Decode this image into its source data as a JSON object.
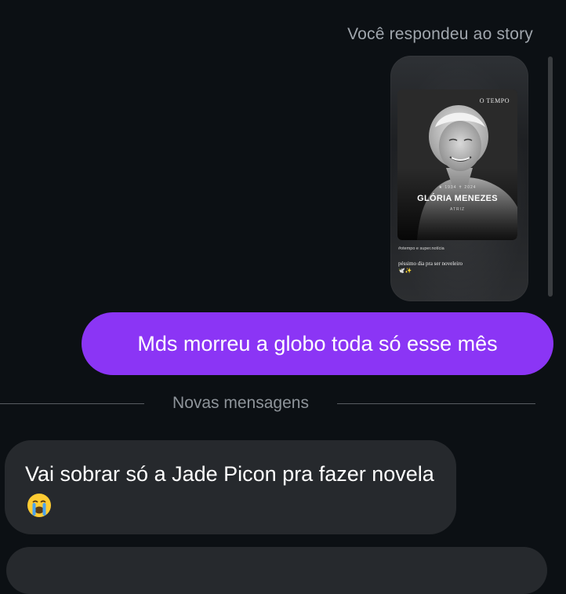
{
  "thread": {
    "reply_context": "Você respondeu ao story"
  },
  "story": {
    "brand": "O TEMPO",
    "symbols": "★ 1934   ✝ 2024",
    "name": "GLÓRIA MENEZES",
    "role": "ATRIZ",
    "hashtag": "#otempo e super.notícia",
    "caption": "péssimo dia pra ser noveleiro 🕊️✨"
  },
  "messages": {
    "sent_text": "Mds morreu a globo toda só esse mês",
    "divider_label": "Novas mensagens",
    "received_text": "Vai sobrar só a Jade Picon pra fazer novela",
    "received_emoji": "crying-face-emoji"
  },
  "colors": {
    "background": "#0c1014",
    "sent_bubble": "#8b35f5",
    "received_bubble": "#26292d",
    "muted_text": "#a0a6ad"
  }
}
